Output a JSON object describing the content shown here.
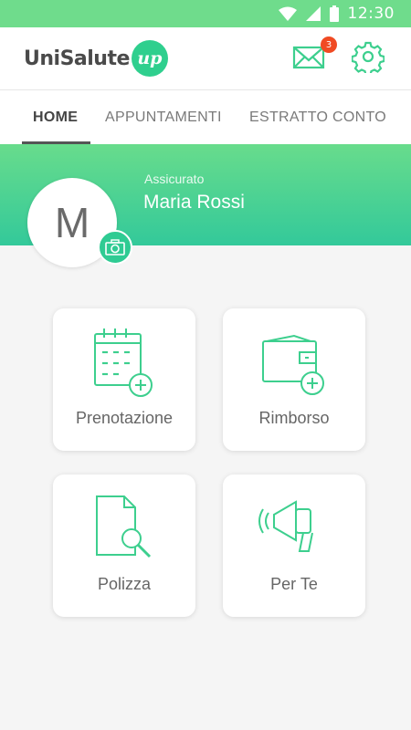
{
  "status_bar": {
    "time": "12:30",
    "icons": [
      "wifi-icon",
      "signal-icon",
      "battery-icon"
    ]
  },
  "header": {
    "logo_text": "UniSalute",
    "logo_badge": "up",
    "mail_badge_count": "3",
    "icons": [
      "mail-icon",
      "gear-icon"
    ]
  },
  "tabs": [
    {
      "label": "HOME",
      "active": true
    },
    {
      "label": "APPUNTAMENTI",
      "active": false
    },
    {
      "label": "ESTRATTO CONTO",
      "active": false
    }
  ],
  "profile": {
    "role": "Assicurato",
    "name": "Maria Rossi",
    "avatar_initial": "M"
  },
  "cards": [
    {
      "label": "Prenotazione",
      "icon": "calendar-add-icon"
    },
    {
      "label": "Rimborso",
      "icon": "wallet-add-icon"
    },
    {
      "label": "Polizza",
      "icon": "document-search-icon"
    },
    {
      "label": "Per Te",
      "icon": "megaphone-icon"
    }
  ],
  "colors": {
    "status_bar": "#6fdc8c",
    "accent_top": "#68dc8c",
    "accent_bottom": "#33c99a",
    "icon_green": "#3dcf8e",
    "badge_red": "#f04a23",
    "background": "#f5f5f5"
  }
}
